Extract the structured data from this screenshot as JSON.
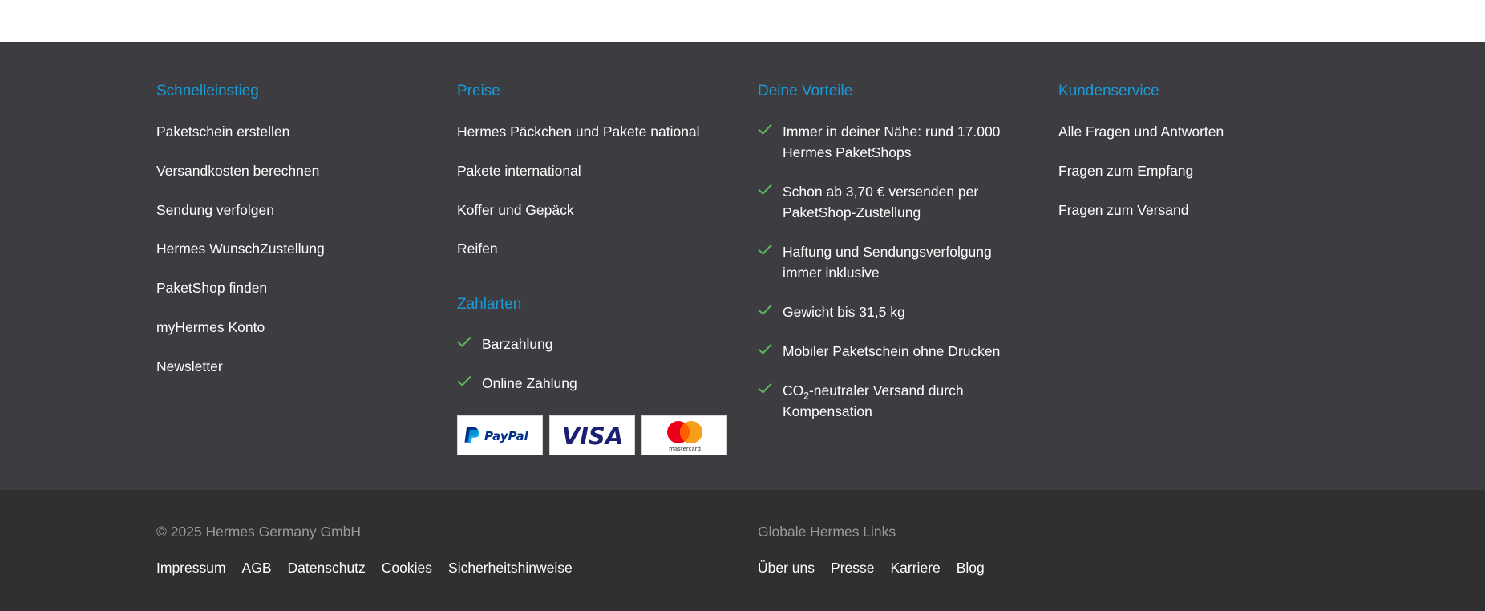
{
  "quick_links": {
    "title": "Schnelleinstieg",
    "items": [
      "Paketschein erstellen",
      "Versandkosten berechnen",
      "Sendung verfolgen",
      "Hermes WunschZustellung",
      "PaketShop finden",
      "myHermes Konto",
      "Newsletter"
    ]
  },
  "prices": {
    "title": "Preise",
    "items": [
      "Hermes Päckchen und Pakete national",
      "Pakete international",
      "Koffer und Gepäck",
      "Reifen"
    ]
  },
  "payment": {
    "title": "Zahlarten",
    "items": [
      "Barzahlung",
      "Online Zahlung"
    ],
    "logos": [
      "PayPal",
      "VISA",
      "mastercard"
    ]
  },
  "benefits": {
    "title": "Deine Vorteile",
    "items": [
      "Immer in deiner Nähe: rund 17.000 Hermes PaketShops",
      "Schon ab 3,70 € versenden per PaketShop-Zustellung",
      "Haftung und Sendungsverfolgung immer inklusive",
      "Gewicht bis 31,5 kg",
      "Mobiler Paketschein ohne Drucken"
    ],
    "co2": {
      "prefix": "CO",
      "sub": "2",
      "suffix": "-neutraler Versand durch Kompensation"
    }
  },
  "customer_service": {
    "title": "Kundenservice",
    "items": [
      "Alle Fragen und Antworten",
      "Fragen zum Empfang",
      "Fragen zum Versand"
    ]
  },
  "bottom": {
    "copyright": "© 2025 Hermes Germany GmbH",
    "legal_links": [
      "Impressum",
      "AGB",
      "Datenschutz",
      "Cookies",
      "Sicherheitshinweise"
    ],
    "global_title": "Globale Hermes Links",
    "global_links": [
      "Über uns",
      "Presse",
      "Karriere",
      "Blog"
    ]
  },
  "colors": {
    "footer_bg": "#3c3c41",
    "bottom_bg": "#303030",
    "heading": "#1a9bd7",
    "check": "#5cb85c"
  },
  "icons": {
    "check": "check-icon"
  }
}
